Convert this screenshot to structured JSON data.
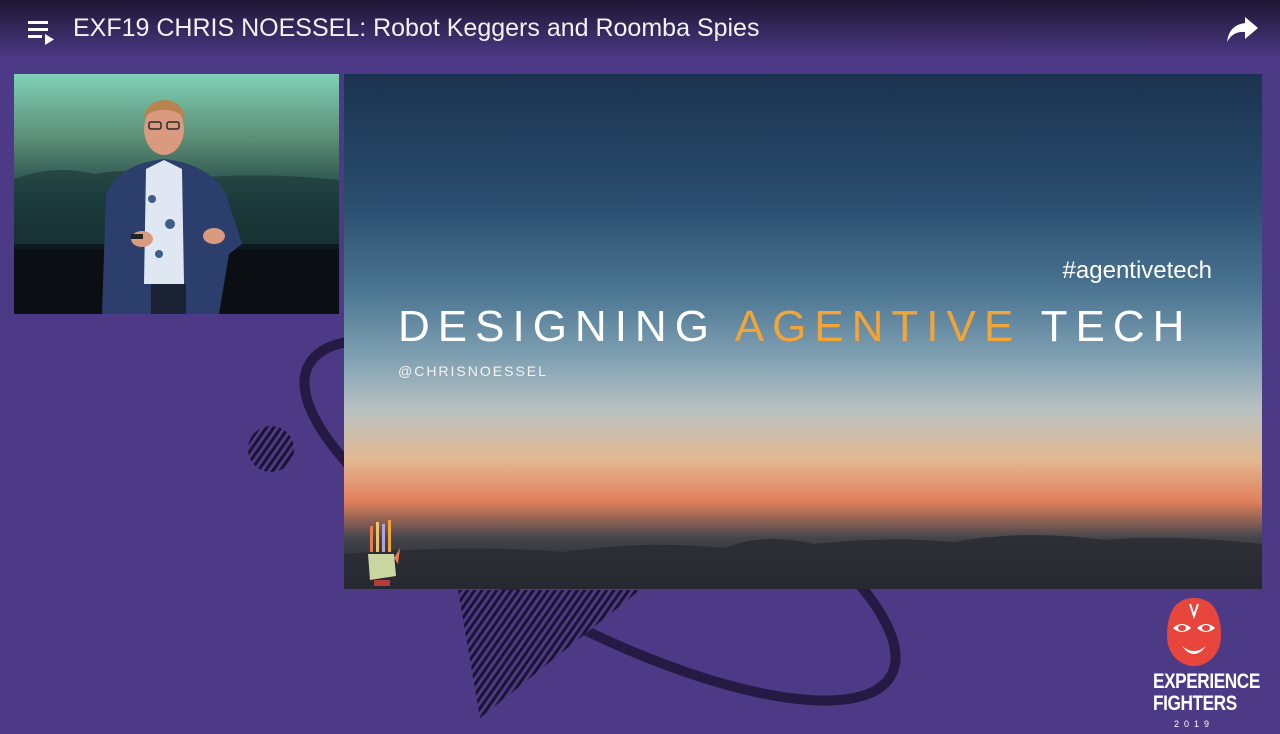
{
  "header": {
    "title": "EXF19 CHRIS NOESSEL: Robot Keggers and Roomba Spies",
    "playlist_icon": "playlist-icon",
    "share_icon": "share-icon"
  },
  "slide": {
    "hashtag": "#agentivetech",
    "headline_part1": "DESIGNING ",
    "headline_accent": "AGENTIVE",
    "headline_part2": " TECH",
    "handle": "@CHRISNOESSEL",
    "accent_color": "#f3a437"
  },
  "logo": {
    "line1": "EXPERIENCE",
    "line2": "FIGHTERS",
    "year": "2019",
    "mask_color": "#e8453c"
  },
  "colors": {
    "background": "#4d3a87"
  }
}
